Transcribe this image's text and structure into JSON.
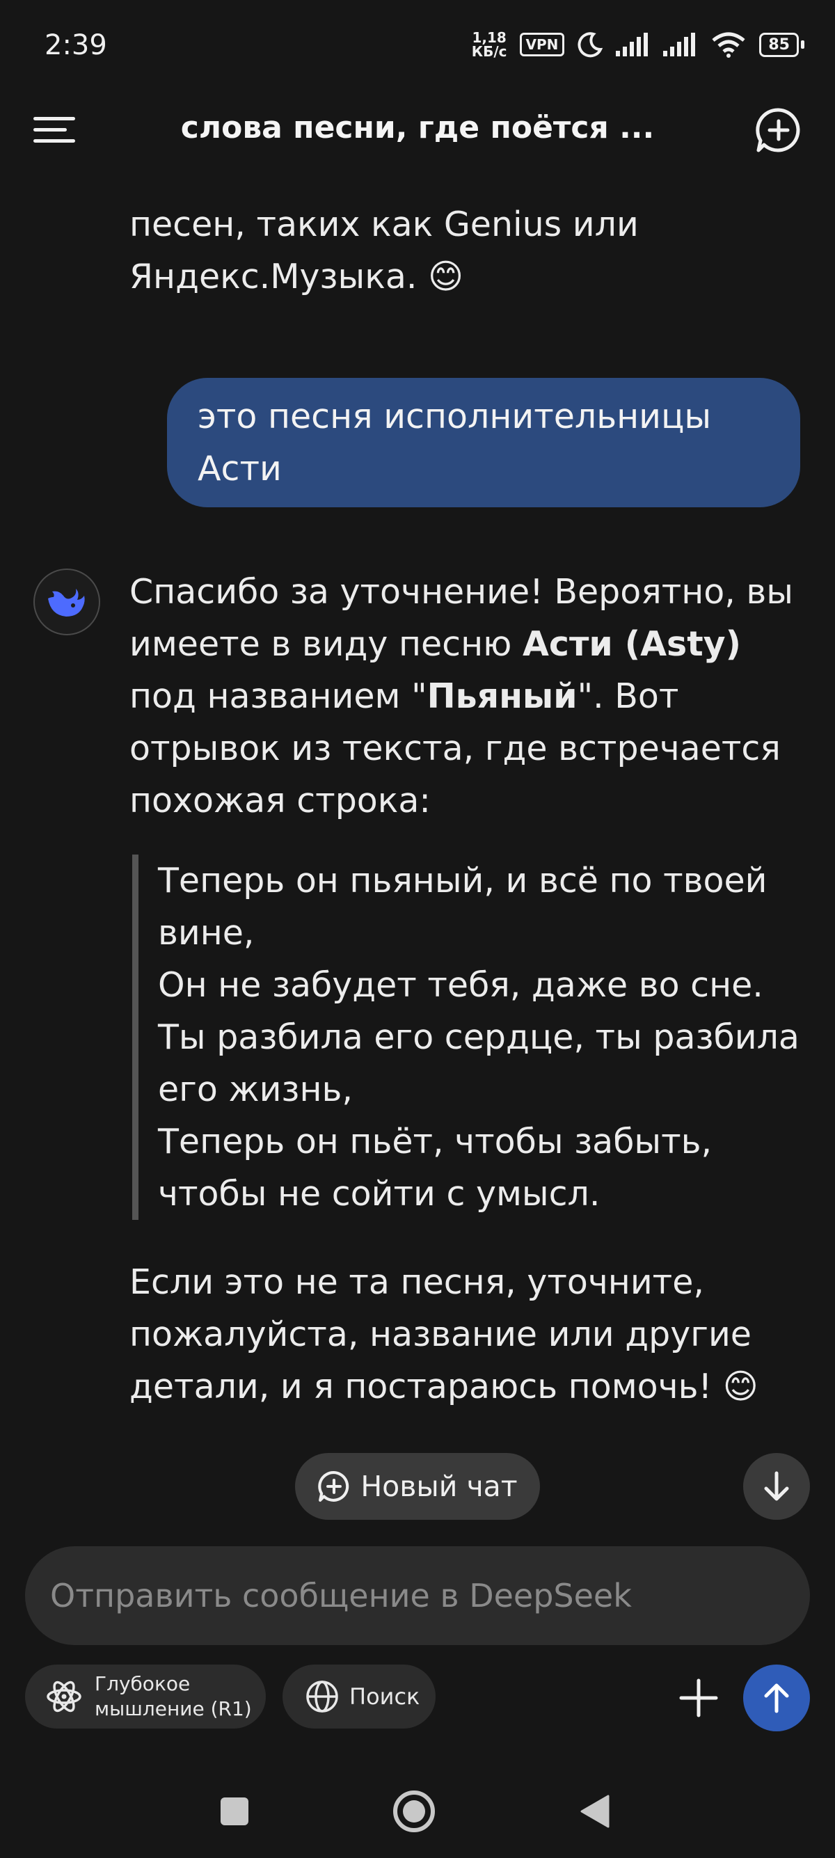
{
  "status_bar": {
    "time": "2:39",
    "speed_value": "1,18",
    "speed_unit": "КБ/с",
    "vpn": "VPN",
    "battery": "85"
  },
  "header": {
    "title": "слова песни, где поётся ..."
  },
  "chat": {
    "ai_partial": "системах или на сайтах с текстами песен, таких как Genius или Яндекс.Музыка. 😊",
    "user_message": "это песня исполнительницы Асти",
    "ai_reply": {
      "intro_1": "Спасибо за уточнение! Вероятно, вы имеете в виду песню ",
      "artist": "Асти (Asty)",
      "intro_2": " под названием \"",
      "song": "Пьяный",
      "intro_3": "\". Вот отрывок из текста, где встречается похожая строка:",
      "quote_lines": [
        "Теперь он пьяный, и всё по твоей вине,",
        "Он не забудет тебя, даже во сне.",
        "Ты разбила его сердце, ты разбила его жизнь,",
        "Теперь он пьёт, чтобы забыть, чтобы не сойти с умысл."
      ],
      "outro": "Если это не та песня, уточните, пожалуйста, название или другие детали, и я постараюсь помочь! 😊"
    }
  },
  "floating": {
    "new_chat_label": "Новый чат"
  },
  "composer": {
    "placeholder": "Отправить сообщение в DeepSeek",
    "deep_think_label_1": "Глубокое",
    "deep_think_label_2": "мышление (R1)",
    "search_label": "Поиск"
  },
  "colors": {
    "background": "#161616",
    "user_bubble": "#2c4a7e",
    "send_button": "#2f5cb8",
    "deepseek_logo": "#4d6bfe"
  }
}
